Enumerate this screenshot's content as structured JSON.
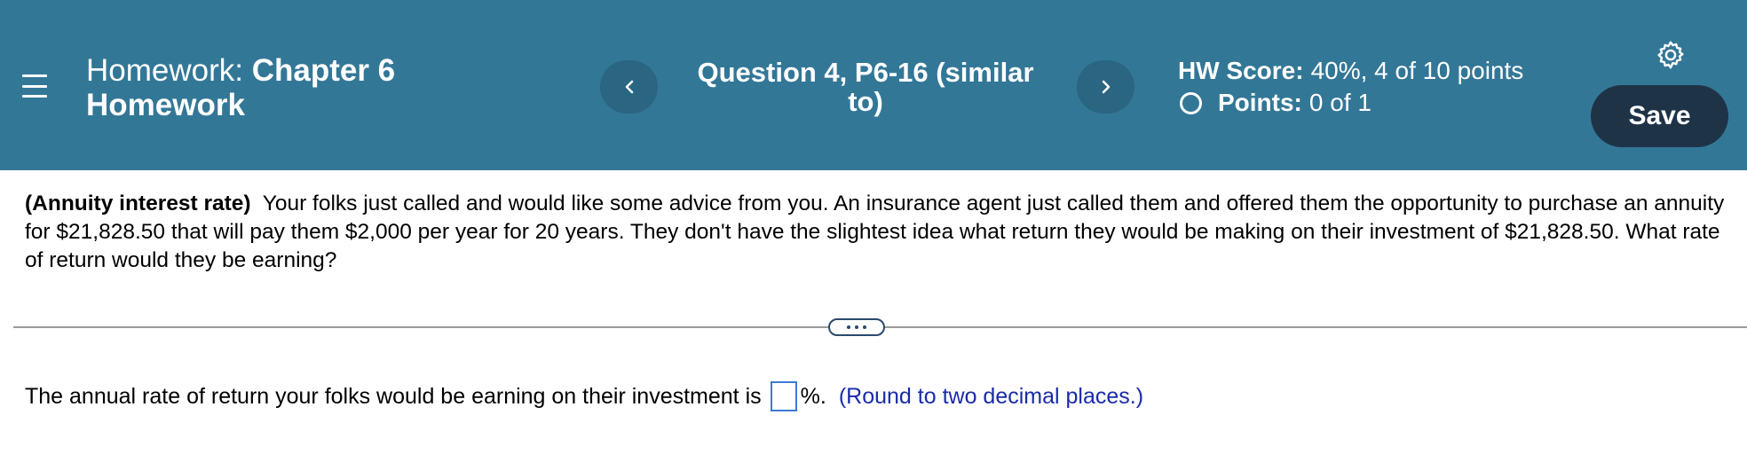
{
  "header": {
    "hw_prefix": "Homework:",
    "hw_name_line1": "Chapter 6",
    "hw_name_line2": "Homework",
    "question_title": "Question 4, P6-16 (similar to)",
    "hw_score_label": "HW Score:",
    "hw_score_value": "40%, 4 of 10 points",
    "points_label": "Points:",
    "points_value": "0 of 1",
    "save_label": "Save",
    "header_color": "#337797",
    "save_color": "#1f3347"
  },
  "question": {
    "topic": "(Annuity interest rate)",
    "body": "Your folks just called and would like some advice from you.  An insurance agent just called them and offered them the opportunity to purchase an annuity for $21,828.50 that will pay them $2,000 per year for 20 years.  They don't have the slightest idea what return they would be making on their investment of $21,828.50.  What rate of return would they be earning?"
  },
  "answer": {
    "prompt": "The annual rate of return your folks would be earning on their investment is",
    "value": "",
    "suffix": "%.",
    "hint": "(Round to two decimal places.)"
  },
  "icons": {
    "menu": "hamburger-menu-icon",
    "prev": "chevron-left-icon",
    "next": "chevron-right-icon",
    "settings": "gear-icon",
    "points_status": "empty-circle-icon",
    "expand": "ellipsis-icon"
  }
}
